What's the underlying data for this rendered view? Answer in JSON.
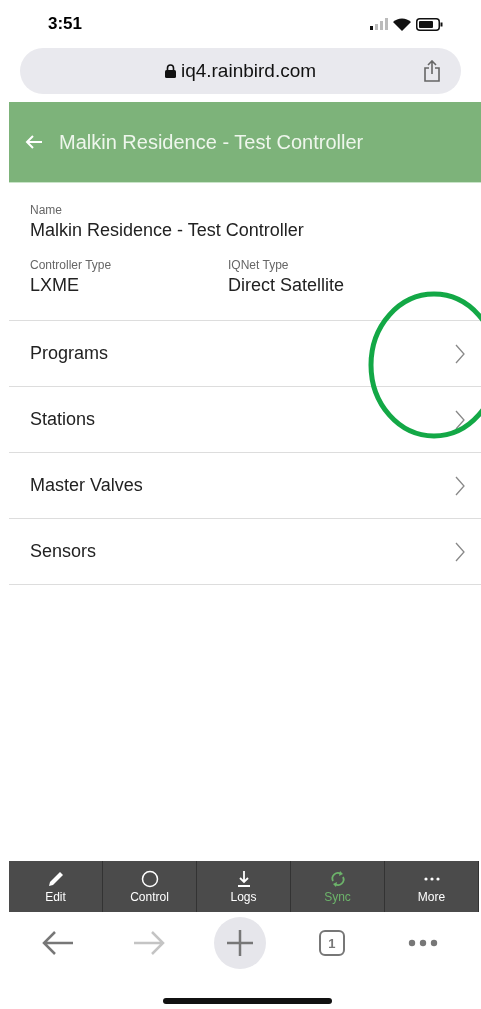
{
  "status_bar": {
    "time": "3:51"
  },
  "address_bar": {
    "url": "iq4.rainbird.com"
  },
  "header": {
    "title": "Malkin Residence - Test Controller"
  },
  "details": {
    "name_label": "Name",
    "name": "Malkin Residence - Test Controller",
    "fields": [
      {
        "label": "Controller Type",
        "value": "LXME"
      },
      {
        "label": "IQNet Type",
        "value": "Direct Satellite"
      }
    ]
  },
  "menu": [
    {
      "label": "Programs"
    },
    {
      "label": "Stations"
    },
    {
      "label": "Master Valves"
    },
    {
      "label": "Sensors"
    }
  ],
  "annotation": {
    "kind": "circle"
  },
  "toolbar": [
    {
      "kind": "edit",
      "label": "Edit",
      "selected": false
    },
    {
      "kind": "control",
      "label": "Control",
      "selected": false
    },
    {
      "kind": "logs",
      "label": "Logs",
      "selected": false
    },
    {
      "kind": "sync",
      "label": "Sync",
      "selected": true
    },
    {
      "kind": "more",
      "label": "More",
      "selected": false
    }
  ],
  "browser_nav": [
    {
      "kind": "back",
      "disabled": false
    },
    {
      "kind": "forward",
      "disabled": true
    },
    {
      "kind": "new",
      "disabled": false
    },
    {
      "kind": "tabs",
      "label": "1",
      "disabled": false
    },
    {
      "kind": "more",
      "disabled": false
    }
  ]
}
